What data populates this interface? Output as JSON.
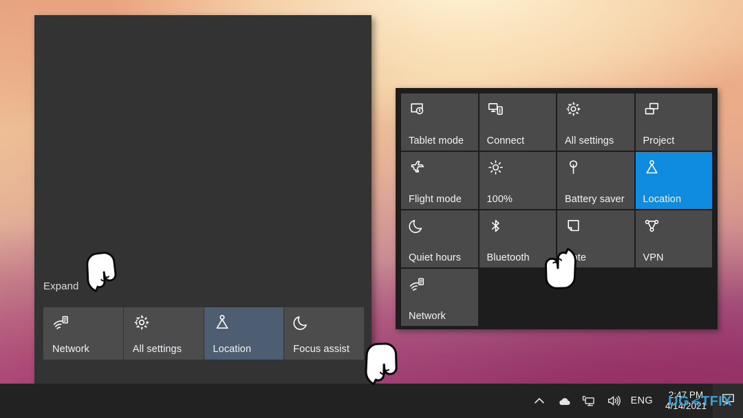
{
  "desktop": {
    "background_description": "warm peach to magenta gradient wallpaper",
    "colors": {
      "gradient_top_left": "#e9a884",
      "gradient_top_mid": "#f3d3a6",
      "gradient_bottom_left": "#a8346 8",
      "gradient_bottom_right": "#8b3570",
      "panel_bg": "#333333",
      "tile_bg": "#4c4c4c",
      "tile_selected_soft": "#4d5e72",
      "tile_selected_blue": "#0f8ce0",
      "taskbar_bg": "#222222",
      "quick_panel_bg": "#1d1d1d",
      "quick_tile_bg": "#4a4a4a",
      "text_primary": "#f2f3f5"
    }
  },
  "action_center": {
    "expand_label": "Expand",
    "tiles": [
      {
        "label": "Network",
        "icon": "network-icon",
        "state": "off"
      },
      {
        "label": "All settings",
        "icon": "gear-icon",
        "state": "off"
      },
      {
        "label": "Location",
        "icon": "location-icon",
        "state": "soft-selected"
      },
      {
        "label": "Focus assist",
        "icon": "moon-icon",
        "state": "off"
      }
    ]
  },
  "quick_panel": {
    "tiles": [
      {
        "label": "Tablet mode",
        "icon": "tablet-mode-icon",
        "state": "off"
      },
      {
        "label": "Connect",
        "icon": "connect-icon",
        "state": "off"
      },
      {
        "label": "All settings",
        "icon": "gear-icon",
        "state": "off"
      },
      {
        "label": "Project",
        "icon": "project-icon",
        "state": "off"
      },
      {
        "label": "Flight mode",
        "icon": "airplane-icon",
        "state": "off"
      },
      {
        "label": "100%",
        "icon": "brightness-icon",
        "state": "off"
      },
      {
        "label": "Battery saver",
        "icon": "battery-saver-icon",
        "state": "off"
      },
      {
        "label": "Location",
        "icon": "location-icon",
        "state": "on"
      },
      {
        "label": "Quiet hours",
        "icon": "moon-icon",
        "state": "off"
      },
      {
        "label": "Bluetooth",
        "icon": "bluetooth-icon",
        "state": "off"
      },
      {
        "label": "Note",
        "icon": "note-icon",
        "state": "off"
      },
      {
        "label": "VPN",
        "icon": "vpn-icon",
        "state": "off"
      },
      {
        "label": "Network",
        "icon": "network-icon",
        "state": "off"
      }
    ]
  },
  "taskbar": {
    "tray": {
      "show_hidden_icons": "chevron-up-icon",
      "onedrive": "cloud-icon",
      "network": "network-monitor-icon",
      "volume": "speaker-icon",
      "language": "ENG",
      "clock_time": "2:47 PM",
      "clock_date": "4/14/2021",
      "action_center": "speech-bubble-icon"
    }
  },
  "cursors": [
    {
      "name": "hand-pointer-expand",
      "target": "Expand link"
    },
    {
      "name": "hand-pointer-taskbar",
      "target": "Action center taskbar button"
    },
    {
      "name": "hand-pointer-note",
      "target": "Quick panel tiles area"
    }
  ],
  "watermark": {
    "prefix": "UG",
    "mark": "e-mark-icon",
    "suffix": "TFIX"
  }
}
